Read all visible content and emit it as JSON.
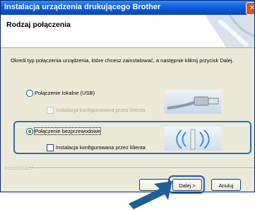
{
  "window": {
    "title": "Instalacja urządzenia drukującego Brother",
    "close_glyph": "✕"
  },
  "header": {
    "title": "Rodzaj połączenia"
  },
  "description": "Określ typ połączenia urządzenia, które chcesz zainstalować, a następnie kliknij przycisk Dalej.",
  "options": [
    {
      "label": "Połączenie lokalne (USB)",
      "selected": false,
      "sub_checkbox_label": "Instalacja konfigurowana przez klienta",
      "sub_checkbox_enabled": false,
      "icon": "usb-cable-icon"
    },
    {
      "label": "Połączenie bezprzewodowe",
      "selected": true,
      "sub_checkbox_label": "Instalacja konfigurowana przez klienta",
      "sub_checkbox_enabled": true,
      "icon": "wireless-antenna-icon"
    }
  ],
  "footer": {
    "brand": "InstallShield",
    "next_label": "Dalej >",
    "cancel_label": "Anuluj"
  },
  "colors": {
    "titlebar": "#0a5fd8",
    "highlight": "#2d6fa8",
    "arrow": "#1f5f96",
    "radio_dot": "#23a123"
  }
}
